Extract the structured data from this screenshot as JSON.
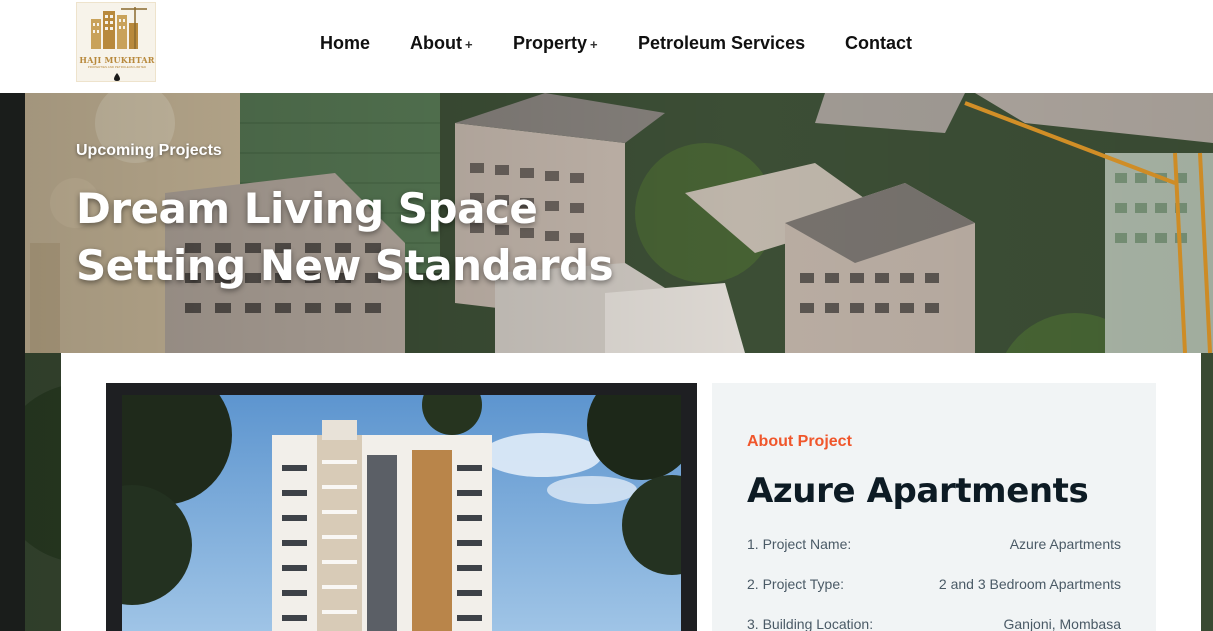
{
  "logo": {
    "name": "HAJI MUKHTAR",
    "subtitle": "PROPERTIES AND PETROLEUM LIMITED"
  },
  "nav": {
    "items": [
      {
        "label": "Home",
        "has_submenu": false
      },
      {
        "label": "About",
        "has_submenu": true
      },
      {
        "label": "Property",
        "has_submenu": true
      },
      {
        "label": "Petroleum Services",
        "has_submenu": false
      },
      {
        "label": "Contact",
        "has_submenu": false
      }
    ],
    "submenu_indicator": "+"
  },
  "hero": {
    "eyebrow": "Upcoming Projects",
    "title_line1": "Dream Living Space",
    "title_line2": "Setting New Standards"
  },
  "project": {
    "eyebrow": "About Project",
    "title": "Azure Apartments",
    "details": [
      {
        "key": "1. Project Name:",
        "value": "Azure Apartments"
      },
      {
        "key": "2. Project Type:",
        "value": "2 and 3 Bedroom Apartments"
      },
      {
        "key": "3. Building Location:",
        "value": "Ganjoni, Mombasa"
      }
    ]
  },
  "colors": {
    "accent": "#f0562b",
    "heading": "#0d1b24",
    "info_bg": "#f1f4f5",
    "logo_gold": "#b8893c"
  }
}
